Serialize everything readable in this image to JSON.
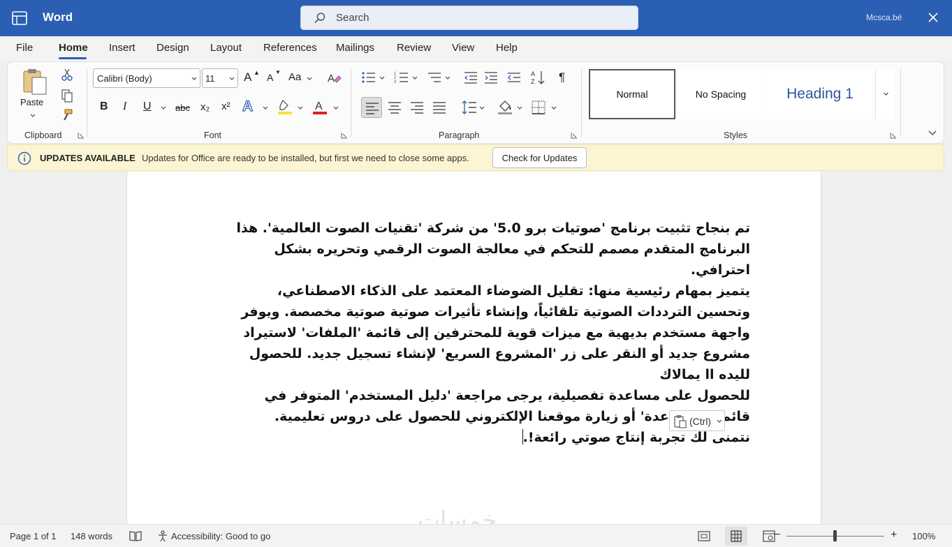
{
  "window": {
    "app_title": "Word",
    "search_placeholder": "Search",
    "user_name": "Mcsca.bé"
  },
  "menu": {
    "tabs": [
      "File",
      "Home",
      "Insert",
      "Design",
      "Layout",
      "References",
      "Mailings",
      "Review",
      "View",
      "Help"
    ],
    "active_tab": "Home"
  },
  "ribbon": {
    "clipboard": {
      "label": "Clipboard",
      "paste_label": "Paste"
    },
    "font": {
      "label": "Font",
      "font_name": "Calibri (Body)",
      "font_size": "11",
      "bold": "B",
      "italic": "I",
      "underline": "U",
      "strike": "abc",
      "subscript": "x₂",
      "superscript": "x²",
      "grow": "A",
      "shrink": "A",
      "case": "Aa",
      "effects": "A",
      "highlight_color": "#f6e23a",
      "font_color": "#e02020"
    },
    "paragraph": {
      "label": "Paragraph"
    },
    "styles": {
      "label": "Styles",
      "items": [
        "Normal",
        "No Spacing",
        "Heading 1"
      ]
    }
  },
  "update_bar": {
    "title": "UPDATES AVAILABLE",
    "message": "Updates for Office are ready to be installed, but first we need to close some apps.",
    "button": "Check for Updates"
  },
  "document": {
    "paragraphs": [
      "تم بنجاح تثبيت برنامج 'صوتيات برو 5.0' من شركة 'تقنيات الصوت العالمية'. هذا البرنامج المتقدم مصمم للتحكم في معالجة الصوت الرقمي وتحريره بشكل احترافي.",
      "يتميز بمهام رئيسية منها: تقليل الضوضاء المعتمد على الذكاء الاصطناعي، وتحسين الترددات الصوتية تلقائياً، وإنشاء تأثيرات صوتية صوتية مخصصة. ويوفر واجهة مستخدم بديهية مع ميزات قوية للمحترفين إلى قائمة 'الملفات' لاستيراد مشروع جديد أو النقر على زر 'المشروع السريع' لإنشاء تسجيل جديد. للحصول لليده اا يمالاك",
      "للحصول على مساعدة تفصيلية، يرجى مراجعة 'دليل المستخدم' المتوفر في قائمة 'المساعدة' أو زيارة موقعنا الإلكتروني للحصول على دروس تعليمية.",
      "نتمنى لك تجربة إنتاج صوتي رائعة!."
    ],
    "paste_options": "(Ctrl)",
    "watermark": "خمسات"
  },
  "status": {
    "page": "Page 1 of 1",
    "words": "148 words",
    "accessibility": "Accessibility: Good to go",
    "zoom": "100%",
    "zoom_level": 100
  },
  "colors": {
    "accent": "#2b5fb4",
    "update_bar_bg": "#fbf5d4"
  }
}
